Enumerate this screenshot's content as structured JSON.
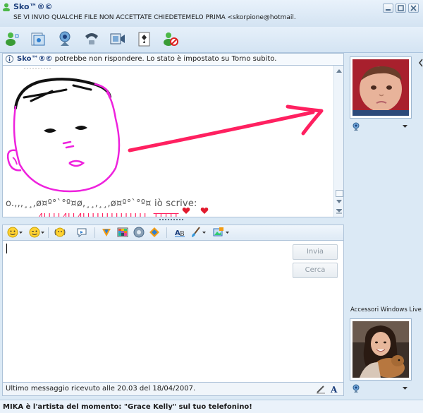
{
  "window": {
    "contact_name": "Sko™®©",
    "status_message": "SE VI INVIO QUALCHE FILE NON ACCETTATE CHIEDETEMELO PRIMA <skorpione@hotmail.co...>"
  },
  "toolbar": {
    "buttons": [
      "add-contact-icon",
      "share-files-icon",
      "webcam-icon",
      "phone-icon",
      "video-icon",
      "games-icon",
      "block-icon"
    ]
  },
  "notice": {
    "contact_name": "Sko™®©",
    "text": " potrebbe non rispondere. Lo stato è impostato su Torno subito."
  },
  "conversation": {
    "sender_line": "o.,,,¸¸,ø¤º°`°º¤ø,¸¸,¸¸,ø¤º°`°º¤ iò scrive:",
    "message": "4LLLL4LL4LLLLLLLLLLLLLL -TTTTT-"
  },
  "buttons": {
    "send": "Invia",
    "search": "Cerca"
  },
  "statusbar": {
    "last_message": "Ultimo messaggio ricevuto alle 20.03 del 18/04/2007."
  },
  "right_pane": {
    "accessori_label": "Accessori Windows Live"
  },
  "ad": {
    "text": "MIKA è l'artista del momento: \"Grace Kelly\" sul tuo telefonino!"
  },
  "colors": {
    "accent": "#1d3f7c",
    "drawing_pink": "#ff2060",
    "drawing_magenta": "#ee22dd"
  }
}
